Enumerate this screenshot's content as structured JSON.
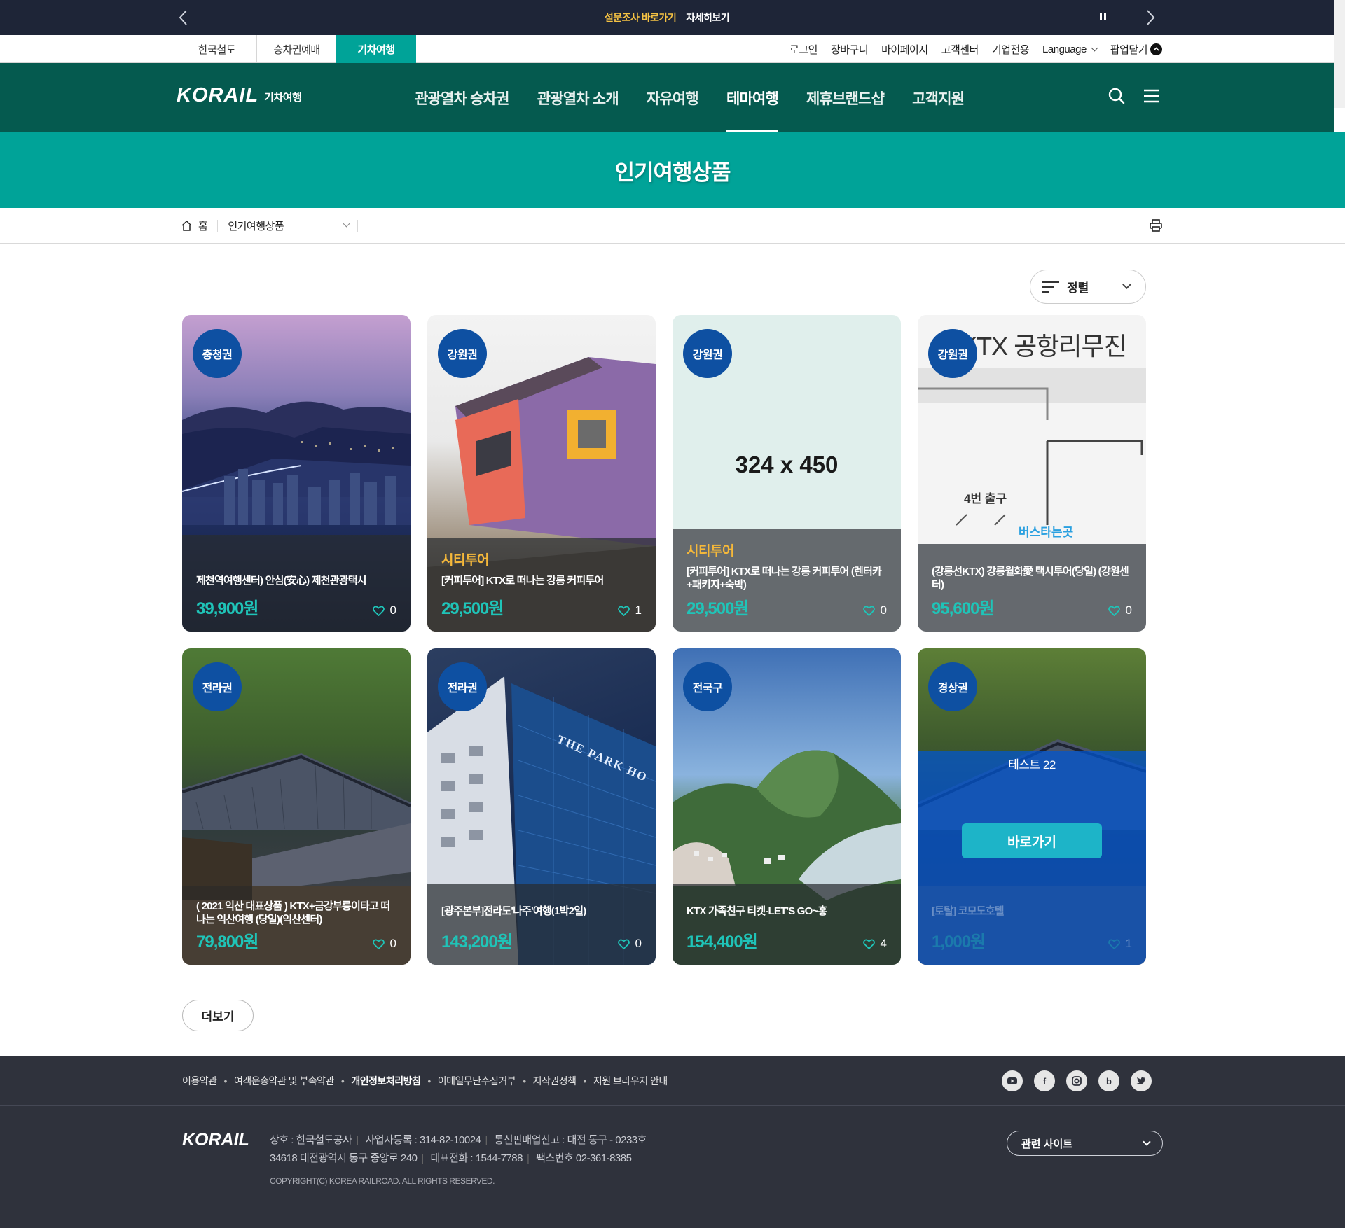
{
  "notice": {
    "text": "설문조사 바로가기",
    "link": "자세히보기"
  },
  "util": {
    "tabs": [
      "한국철도",
      "승차권예매",
      "기차여행"
    ],
    "links": [
      "로그인",
      "장바구니",
      "마이페이지",
      "고객센터",
      "기업전용",
      "Language",
      "팝업닫기"
    ]
  },
  "gnb": {
    "brand": "KORAIL",
    "sub": "기차여행",
    "menu": [
      "관광열차 승차권",
      "관광열차 소개",
      "자유여행",
      "테마여행",
      "제휴브랜드샵",
      "고객지원"
    ],
    "active_index": 3
  },
  "page": {
    "title": "인기여행상품"
  },
  "breadcrumb": {
    "home": "홈",
    "current": "인기여행상품"
  },
  "sort": {
    "label": "정렬"
  },
  "products": [
    {
      "region": "충청권",
      "tag": "",
      "name": "제천역여행센터) 안심(安心) 제천관광택시",
      "price": "39,900원",
      "likes": "0"
    },
    {
      "region": "강원권",
      "tag": "시티투어",
      "name": "[커피투어] KTX로 떠나는 강릉 커피투어",
      "price": "29,500원",
      "likes": "1"
    },
    {
      "region": "강원권",
      "tag": "시티투어",
      "name": "[커피투어] KTX로 떠나는 강릉 커피투어 (렌터카+패키지+숙박)",
      "price": "29,500원",
      "likes": "0",
      "placeholder": "324 x 450"
    },
    {
      "region": "강원권",
      "tag": "",
      "name": "(강릉선KTX) 강릉월화愛 택시투어(당일) (강원센터)",
      "price": "95,600원",
      "likes": "0",
      "image_text": "앞 KTX 공항리무진",
      "image_label_1": "4번 출구",
      "image_label_2": "버스타는곳"
    },
    {
      "region": "전라권",
      "tag": "",
      "name": "( 2021 익산 대표상품 ) KTX+금강부릉이타고 떠나는 익산여행 (당일)(익산센터)",
      "price": "79,800원",
      "likes": "0"
    },
    {
      "region": "전라권",
      "tag": "",
      "name": "[광주본부]전라도'나주'여행(1박2일)",
      "price": "143,200원",
      "likes": "0",
      "image_text": "THE PARK HO"
    },
    {
      "region": "전국구",
      "tag": "",
      "name": "KTX 가족친구 티켓-LET'S GO~홍",
      "price": "154,400원",
      "likes": "4"
    },
    {
      "region": "경상권",
      "tag": "",
      "name": "[토탈] 코모도호텔",
      "price": "1,000원",
      "likes": "1",
      "hover_title": "테스트 22",
      "hover_button": "바로가기"
    }
  ],
  "more_button": "더보기",
  "footer": {
    "links": [
      "이용약관",
      "여객운송약관 및 부속약관",
      "개인정보처리방침",
      "이메일무단수집거부",
      "저작권정책",
      "지원 브라우저 안내"
    ],
    "sns": [
      "youtube",
      "facebook",
      "instagram",
      "blog",
      "twitter"
    ],
    "brand": "KORAIL",
    "line1": [
      "상호 : 한국철도공사",
      "사업자등록 : 314-82-10024",
      "통신판매업신고 : 대전 동구 - 0233호"
    ],
    "line2": [
      "34618 대전광역시 동구 중앙로 240",
      "대표전화 : 1544-7788",
      "팩스번호 02-361-8385"
    ],
    "copyright": "COPYRIGHT(C) KOREA RAILROAD. ALL RIGHTS RESERVED.",
    "family_site": "관련 사이트"
  },
  "colors": {
    "notice_bg": "#1e2537",
    "gnb_bg": "#055a4f",
    "accent": "#00a398",
    "badge": "#0e50a2",
    "price": "#1fc4b8",
    "footer_bg": "#2f323c"
  }
}
